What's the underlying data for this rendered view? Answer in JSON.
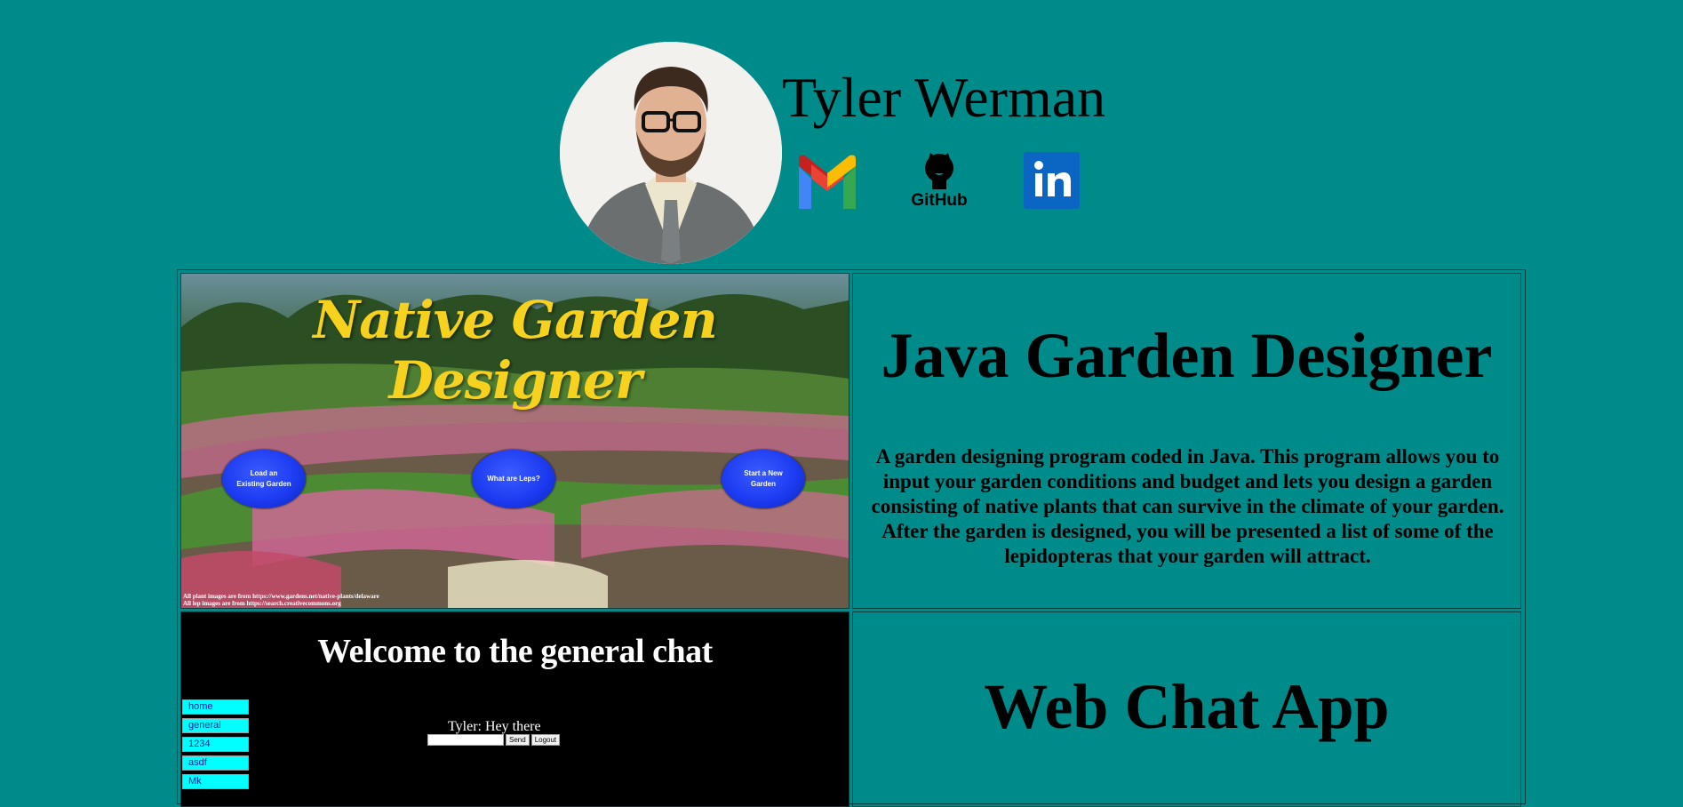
{
  "header": {
    "name": "Tyler Werman",
    "links": [
      {
        "label": "Gmail",
        "icon": "gmail-icon"
      },
      {
        "label": "GitHub",
        "icon": "github-icon"
      },
      {
        "label": "in",
        "icon": "linkedin-icon"
      }
    ]
  },
  "projects": [
    {
      "title": "Java Garden Designer",
      "description": "A garden designing program coded in Java. This program allows you to input your garden conditions and budget and lets you design a garden consisting of native plants that can survive in the climate of your garden. After the garden is designed, you will be presented a list of some of the lepidopteras that your garden will attract.",
      "screenshot": {
        "title": "Native Garden Designer",
        "buttons": [
          "Load an Existing Garden",
          "What are Leps?",
          "Start a New Garden"
        ],
        "credits": [
          "All plant images are from https://www.gardens.net/native-plants/delaware",
          "All lep images are from https://search.creativecommons.org"
        ]
      }
    },
    {
      "title": "Web Chat App",
      "screenshot": {
        "title": "Welcome to the general chat",
        "message": "Tyler: Hey there",
        "send_label": "Send",
        "logout_label": "Logout",
        "rooms": [
          "home",
          "general",
          "1234",
          "asdf",
          "Mk"
        ]
      }
    }
  ],
  "colors": {
    "background": "#008b8b",
    "chat_room_bg": "#00ffff",
    "garden_title": "#f6d21e",
    "garden_button": "#1d3cf2"
  }
}
